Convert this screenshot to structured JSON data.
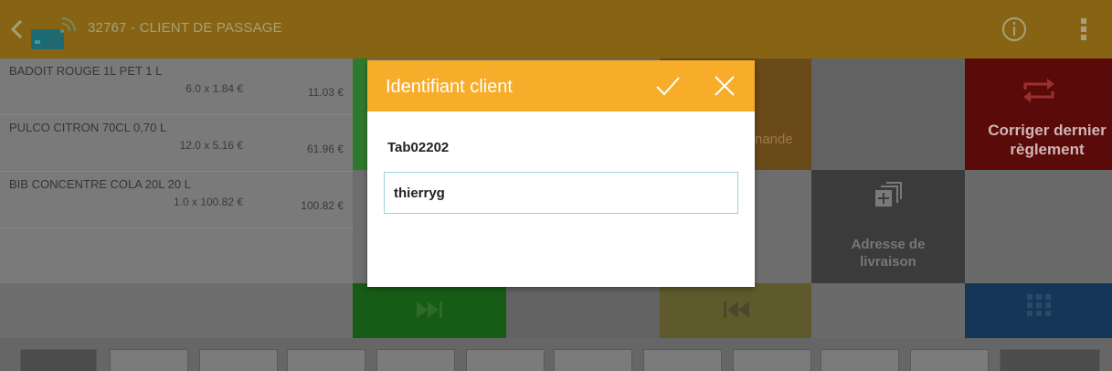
{
  "header": {
    "title": "32767 - CLIENT DE PASSAGE",
    "back_icon": "chevron-left-icon",
    "card_icon": "nfc-card-icon",
    "info_icon": "info-icon",
    "menu_icon": "overflow-menu-icon"
  },
  "items": [
    {
      "name": "BADOIT ROUGE 1L PET   1 L",
      "qty": "6.0 x 1.84 €",
      "total": "11.03 €"
    },
    {
      "name": "PULCO CITRON 70CL   0,70 L",
      "qty": "12.0 x 5.16 €",
      "total": "61.96 €"
    },
    {
      "name": "BIB CONCENTRE COLA 20L   20 L",
      "qty": "1.0 x 100.82 €",
      "total": "100.82 €"
    }
  ],
  "tiles": {
    "commande_fragment": "nande",
    "corriger_line1": "Corriger dernier",
    "corriger_line2": "règlement",
    "adresse_line1": "Adresse de",
    "adresse_line2": "livraison"
  },
  "dialog": {
    "title": "Identifiant client",
    "label": "Tab02202",
    "input_value": "thierryg"
  },
  "colors": {
    "topbar": "#876414",
    "dialog_header": "#f7ac2a",
    "input_border": "#9fd3e0"
  }
}
